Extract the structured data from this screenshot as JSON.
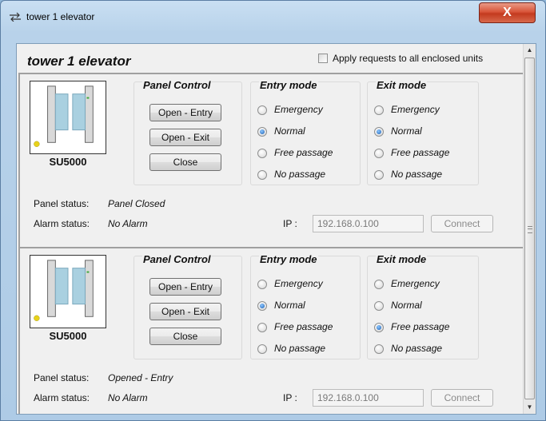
{
  "window": {
    "title": "tower 1 elevator",
    "close_label": "X"
  },
  "header": {
    "title": "tower 1 elevator",
    "apply_all_label": "Apply requests to all enclosed units",
    "apply_all_checked": false
  },
  "units": [
    {
      "device_name": "SU5000",
      "panel_control": {
        "title": "Panel Control",
        "buttons": [
          "Open - Entry",
          "Open - Exit",
          "Close"
        ]
      },
      "entry_mode": {
        "title": "Entry mode",
        "options": [
          "Emergency",
          "Normal",
          "Free passage",
          "No passage"
        ],
        "selected": "Normal"
      },
      "exit_mode": {
        "title": "Exit mode",
        "options": [
          "Emergency",
          "Normal",
          "Free passage",
          "No passage"
        ],
        "selected": "Normal"
      },
      "panel_status_label": "Panel status:",
      "panel_status": "Panel Closed",
      "alarm_status_label": "Alarm status:",
      "alarm_status": "No Alarm",
      "ip_label": "IP :",
      "ip": "192.168.0.100",
      "connect_label": "Connect"
    },
    {
      "device_name": "SU5000",
      "panel_control": {
        "title": "Panel Control",
        "buttons": [
          "Open - Entry",
          "Open - Exit",
          "Close"
        ]
      },
      "entry_mode": {
        "title": "Entry mode",
        "options": [
          "Emergency",
          "Normal",
          "Free passage",
          "No passage"
        ],
        "selected": "Normal"
      },
      "exit_mode": {
        "title": "Exit mode",
        "options": [
          "Emergency",
          "Normal",
          "Free passage",
          "No passage"
        ],
        "selected": "Free passage"
      },
      "panel_status_label": "Panel status:",
      "panel_status": "Opened - Entry",
      "alarm_status_label": "Alarm status:",
      "alarm_status": "No Alarm",
      "ip_label": "IP :",
      "ip": "192.168.0.100",
      "connect_label": "Connect"
    }
  ],
  "colors": {
    "titlebar": "#b8d2ea",
    "close_button": "#c33a1f",
    "radio_selected": "#1a5fb4",
    "device_led": "#e8d21a"
  }
}
